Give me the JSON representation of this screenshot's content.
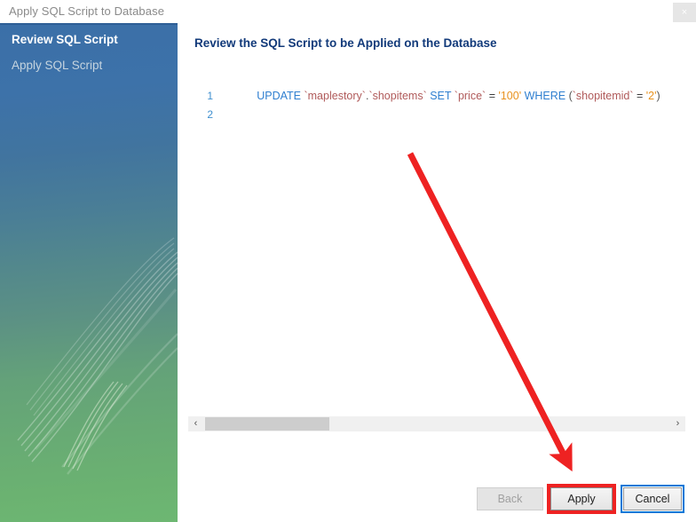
{
  "window": {
    "title": "Apply SQL Script to Database",
    "close_icon": "close-icon",
    "close_label": "×"
  },
  "sidebar": {
    "items": [
      {
        "label": "Review SQL Script",
        "state": "active"
      },
      {
        "label": "Apply SQL Script",
        "state": "inactive"
      }
    ]
  },
  "main": {
    "heading": "Review the SQL Script to be Applied on the Database"
  },
  "code": {
    "lines": [
      {
        "number": "1",
        "tokens": [
          {
            "text": "UPDATE ",
            "type": "kw"
          },
          {
            "text": "`maplestory`",
            "type": "ident"
          },
          {
            "text": ".",
            "type": "punct"
          },
          {
            "text": "`shopitems` ",
            "type": "ident"
          },
          {
            "text": "SET ",
            "type": "kw"
          },
          {
            "text": "`price` ",
            "type": "ident"
          },
          {
            "text": "= ",
            "type": "plain"
          },
          {
            "text": "'100' ",
            "type": "str"
          },
          {
            "text": "WHERE ",
            "type": "kw"
          },
          {
            "text": "(",
            "type": "punct"
          },
          {
            "text": "`shopitemid` ",
            "type": "ident"
          },
          {
            "text": "= ",
            "type": "plain"
          },
          {
            "text": "'2'",
            "type": "str"
          },
          {
            "text": ")",
            "type": "punct"
          }
        ]
      },
      {
        "number": "2",
        "tokens": []
      }
    ]
  },
  "scrollbar": {
    "left_arrow": "‹",
    "right_arrow": "›"
  },
  "footer": {
    "buttons": [
      {
        "label": "Back",
        "state": "disabled"
      },
      {
        "label": "Apply",
        "state": "highlighted"
      },
      {
        "label": "Cancel",
        "state": "focused"
      }
    ]
  },
  "annotations": {
    "arrow_color": "#ee2222",
    "box_color": "#ee2222",
    "focus_color": "#0078d7"
  }
}
